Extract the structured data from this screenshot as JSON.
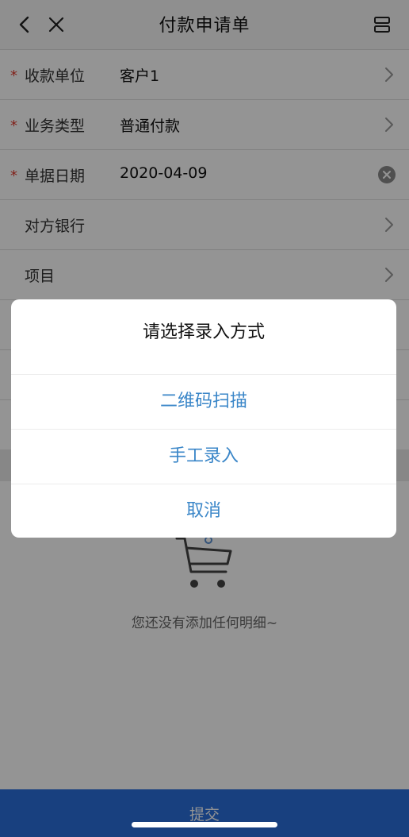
{
  "header": {
    "title": "付款申请单"
  },
  "form": {
    "rows": [
      {
        "label": "收款单位",
        "value": "客户1",
        "required": true
      },
      {
        "label": "业务类型",
        "value": "普通付款",
        "required": true
      },
      {
        "label": "单据日期",
        "value": "2020-04-09",
        "required": true
      },
      {
        "label": "对方银行",
        "value": "",
        "required": false
      },
      {
        "label": "项目",
        "value": "",
        "required": false
      }
    ],
    "required_mark": "*"
  },
  "empty_state": {
    "text": "您还没有添加任何明细~"
  },
  "submit": {
    "label": "提交"
  },
  "dialog": {
    "title": "请选择录入方式",
    "options": [
      "二维码扫描",
      "手工录入",
      "取消"
    ]
  },
  "colors": {
    "accent": "#3a86c8",
    "submit_bar": "#2a6fdb",
    "required": "#e03a2e"
  },
  "icons": {
    "back": "chevron-left-icon",
    "close": "close-icon",
    "more": "layout-icon",
    "chevron": "chevron-right-icon",
    "clear": "clear-icon",
    "cart": "cart-icon"
  }
}
